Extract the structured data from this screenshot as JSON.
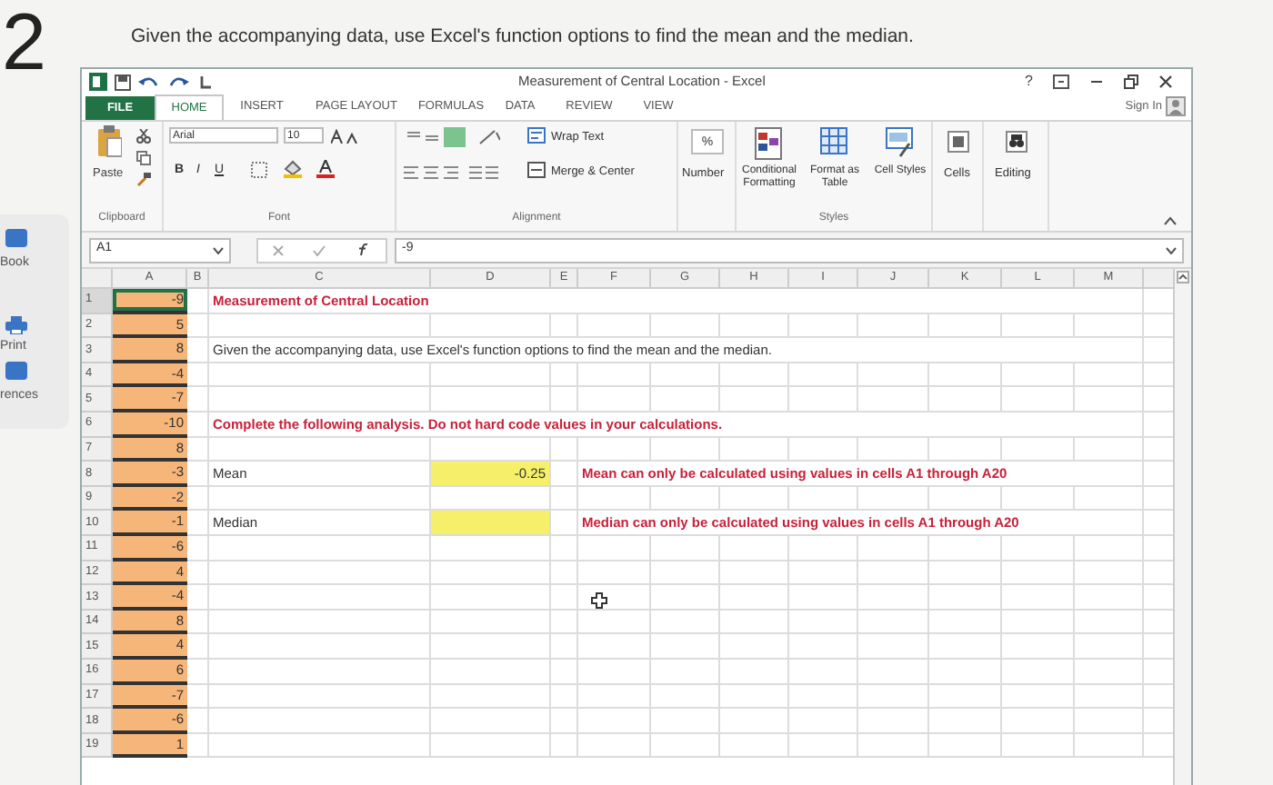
{
  "question": {
    "number": "2",
    "text": "Given the accompanying data, use Excel's function options to find the mean and the median."
  },
  "sidebar": {
    "items": [
      {
        "label": "Book"
      },
      {
        "label": "Print"
      },
      {
        "label": "rences"
      }
    ]
  },
  "excel": {
    "title": "Measurement of Central Location - Excel",
    "help": "?",
    "sign_in": "Sign In",
    "tabs": [
      {
        "label": "FILE",
        "kind": "file",
        "selected": false
      },
      {
        "label": "HOME",
        "kind": "tab",
        "selected": true
      },
      {
        "label": "INSERT",
        "kind": "tab",
        "selected": false
      },
      {
        "label": "PAGE LAYOUT",
        "kind": "tab",
        "selected": false
      },
      {
        "label": "FORMULAS",
        "kind": "tab",
        "selected": false
      },
      {
        "label": "DATA",
        "kind": "tab",
        "selected": false
      },
      {
        "label": "REVIEW",
        "kind": "tab",
        "selected": false
      },
      {
        "label": "VIEW",
        "kind": "tab",
        "selected": false
      }
    ],
    "ribbon": {
      "paste": "Paste",
      "clipboard": "Clipboard",
      "font_name": "Arial",
      "font_size": "10",
      "font": "Font",
      "bold": "B",
      "italic": "I",
      "underline": "U",
      "wrap_text": "Wrap Text",
      "merge_center": "Merge & Center",
      "alignment": "Alignment",
      "number": "Number",
      "percent": "%",
      "conditional_formatting": "Conditional Formatting",
      "format_as_table": "Format as Table",
      "cell_styles": "Cell Styles",
      "styles": "Styles",
      "cells": "Cells",
      "editing": "Editing"
    },
    "name_box": "A1",
    "formula": "-9",
    "columns": [
      "A",
      "B",
      "C",
      "D",
      "E",
      "F",
      "G",
      "H",
      "I",
      "J",
      "K",
      "L",
      "M"
    ],
    "rows": [
      {
        "number": "1",
        "a": "-9",
        "selected": true,
        "c": {
          "text": "Measurement of Central Location",
          "kind": "heading"
        }
      },
      {
        "number": "2",
        "a": "5",
        "selected": false
      },
      {
        "number": "3",
        "a": "8",
        "selected": false,
        "c": {
          "text": "Given the accompanying data, use Excel's function options to find the mean and the median.",
          "kind": "plain"
        }
      },
      {
        "number": "4",
        "a": "-4",
        "selected": false
      },
      {
        "number": "5",
        "a": "-7",
        "selected": false
      },
      {
        "number": "6",
        "a": "-10",
        "selected": false,
        "c": {
          "text": "Complete the following analysis. Do not hard code values in your calculations.",
          "kind": "heading"
        }
      },
      {
        "number": "7",
        "a": "8",
        "selected": false
      },
      {
        "number": "8",
        "a": "-3",
        "selected": false,
        "c": {
          "text": "Mean",
          "kind": "plain"
        },
        "d": {
          "text": "-0.25",
          "highlighted": true
        },
        "f": {
          "text": "Mean can only be calculated using values in cells A1 through A20",
          "kind": "heading"
        }
      },
      {
        "number": "9",
        "a": "-2",
        "selected": false
      },
      {
        "number": "10",
        "a": "-1",
        "selected": false,
        "c": {
          "text": "Median",
          "kind": "plain"
        },
        "d": {
          "highlighted": true
        },
        "f": {
          "text": "Median can only be calculated using values in cells A1 through A20",
          "kind": "heading"
        }
      },
      {
        "number": "11",
        "a": "-6",
        "selected": false
      },
      {
        "number": "12",
        "a": "4",
        "selected": false
      },
      {
        "number": "13",
        "a": "-4",
        "selected": false
      },
      {
        "number": "14",
        "a": "8",
        "selected": false
      },
      {
        "number": "15",
        "a": "4",
        "selected": false
      },
      {
        "number": "16",
        "a": "6",
        "selected": false
      },
      {
        "number": "17",
        "a": "-7",
        "selected": false
      },
      {
        "number": "18",
        "a": "-6",
        "selected": false
      },
      {
        "number": "19",
        "a": "1",
        "selected": false
      }
    ]
  }
}
